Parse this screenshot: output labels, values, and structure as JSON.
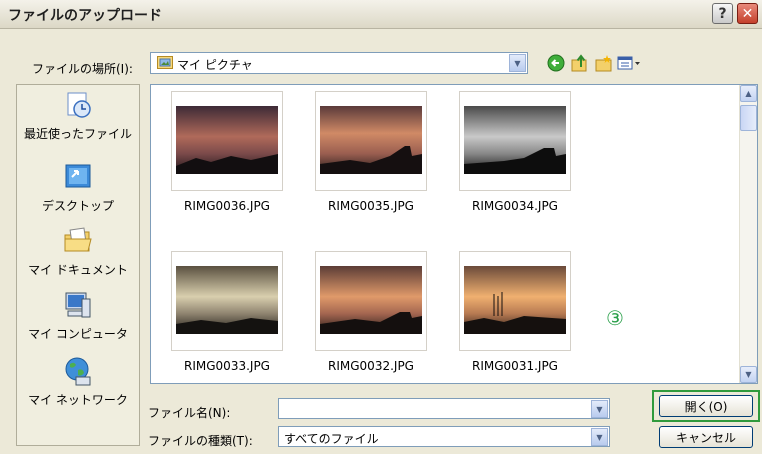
{
  "window": {
    "title": "ファイルのアップロード",
    "help_label": "?",
    "close_label": "✕"
  },
  "lookin": {
    "label": "ファイルの場所(I):",
    "value": "マイ ピクチャ",
    "icon": "folder-pictures-icon"
  },
  "toolbar": {
    "icons": [
      "back-icon",
      "up-folder-icon",
      "new-folder-icon",
      "view-menu-icon"
    ]
  },
  "places": [
    {
      "label": "最近使ったファイル",
      "icon": "recent-files-icon"
    },
    {
      "label": "デスクトップ",
      "icon": "desktop-icon"
    },
    {
      "label": "マイ ドキュメント",
      "icon": "my-documents-icon"
    },
    {
      "label": "マイ コンピュータ",
      "icon": "my-computer-icon"
    },
    {
      "label": "マイ ネットワーク",
      "icon": "my-network-icon"
    }
  ],
  "files": [
    {
      "name": "RIMG0036.JPG",
      "selected": true
    },
    {
      "name": "RIMG0035.JPG",
      "selected": false
    },
    {
      "name": "RIMG0034.JPG",
      "selected": false
    },
    {
      "name": "RIMG0033.JPG",
      "selected": false
    },
    {
      "name": "RIMG0032.JPG",
      "selected": false
    },
    {
      "name": "RIMG0031.JPG",
      "selected": false
    }
  ],
  "annotation": "③",
  "filename": {
    "label": "ファイル名(N):",
    "value": ""
  },
  "filetype": {
    "label": "ファイルの種類(T):",
    "value": "すべてのファイル"
  },
  "buttons": {
    "open": "開く(O)",
    "cancel": "キャンセル"
  },
  "colors": {
    "titlebar": "#e8e5d8",
    "highlight": "#2f9a3c",
    "annotation": "#2aa04a",
    "pane_border": "#7f9db9"
  }
}
